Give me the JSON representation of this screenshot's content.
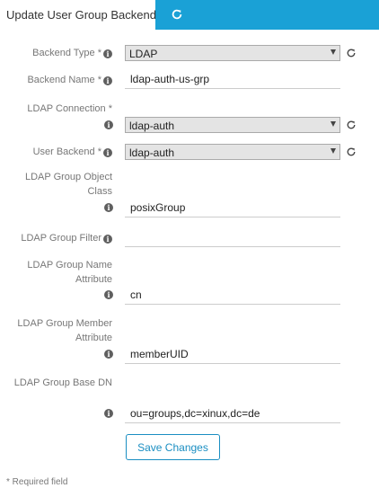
{
  "colors": {
    "accent": "#1aa1d6",
    "button": "#1a8ec2"
  },
  "tabs": [
    {
      "label": "Update User Group Backend",
      "active": true
    },
    {
      "icon": "refresh-icon",
      "active": false
    }
  ],
  "form": {
    "backend_type": {
      "label": "Backend Type *",
      "value": "LDAP"
    },
    "backend_name": {
      "label": "Backend Name *",
      "value": "ldap-auth-us-grp"
    },
    "ldap_connection": {
      "label": "LDAP Connection *",
      "value": "ldap-auth"
    },
    "user_backend": {
      "label": "User Backend *",
      "value": "ldap-auth"
    },
    "group_object_class": {
      "label": "LDAP Group Object Class",
      "value": "posixGroup"
    },
    "group_filter": {
      "label": "LDAP Group Filter",
      "value": ""
    },
    "group_name_attribute": {
      "label": "LDAP Group Name Attribute",
      "value": "cn"
    },
    "group_member_attribute": {
      "label": "LDAP Group Member Attribute",
      "value": "memberUID"
    },
    "group_base_dn": {
      "label": "LDAP Group Base DN",
      "value": "ou=groups,dc=xinux,dc=de"
    }
  },
  "save_label": "Save Changes",
  "required_note": "* Required field"
}
